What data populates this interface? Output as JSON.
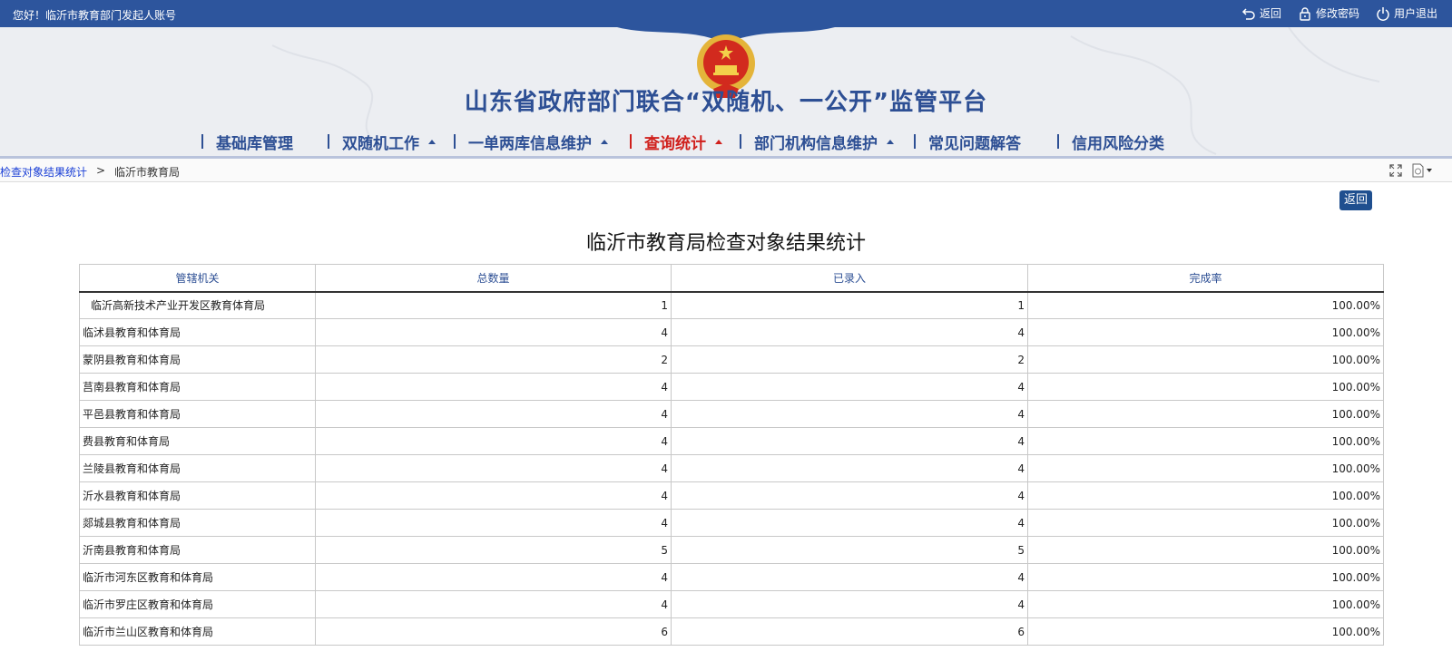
{
  "topbar": {
    "greeting": "您好！临沂市教育部门发起人账号",
    "links": [
      {
        "label": "返回",
        "icon": "back-arrow-icon"
      },
      {
        "label": "修改密码",
        "icon": "lock-icon"
      },
      {
        "label": "用户退出",
        "icon": "power-icon"
      }
    ]
  },
  "header": {
    "title": "山东省政府部门联合“双随机、一公开”监管平台",
    "emblem": "national-emblem"
  },
  "nav": [
    {
      "label": "基础库管理",
      "dropdown": false,
      "active": false
    },
    {
      "label": "双随机工作",
      "dropdown": true,
      "active": false
    },
    {
      "label": "一单两库信息维护",
      "dropdown": true,
      "active": false
    },
    {
      "label": "查询统计",
      "dropdown": true,
      "active": true
    },
    {
      "label": "部门机构信息维护",
      "dropdown": true,
      "active": false
    },
    {
      "label": "常见问题解答",
      "dropdown": false,
      "active": false
    },
    {
      "label": "信用风险分类",
      "dropdown": false,
      "active": false
    }
  ],
  "breadcrumb": {
    "link": "检查对象结果统计",
    "separator": ">",
    "current": "临沂市教育局"
  },
  "back_button": "返回",
  "report": {
    "title": "临沂市教育局检查对象结果统计",
    "columns": [
      "管辖机关",
      "总数量",
      "已录入",
      "完成率"
    ],
    "rows": [
      [
        "临沂高新技术产业开发区教育体育局",
        "1",
        "1",
        "100.00%"
      ],
      [
        "临沭县教育和体育局",
        "4",
        "4",
        "100.00%"
      ],
      [
        "蒙阴县教育和体育局",
        "2",
        "2",
        "100.00%"
      ],
      [
        "莒南县教育和体育局",
        "4",
        "4",
        "100.00%"
      ],
      [
        "平邑县教育和体育局",
        "4",
        "4",
        "100.00%"
      ],
      [
        "费县教育和体育局",
        "4",
        "4",
        "100.00%"
      ],
      [
        "兰陵县教育和体育局",
        "4",
        "4",
        "100.00%"
      ],
      [
        "沂水县教育和体育局",
        "4",
        "4",
        "100.00%"
      ],
      [
        "郯城县教育和体育局",
        "4",
        "4",
        "100.00%"
      ],
      [
        "沂南县教育和体育局",
        "5",
        "5",
        "100.00%"
      ],
      [
        "临沂市河东区教育和体育局",
        "4",
        "4",
        "100.00%"
      ],
      [
        "临沂市罗庄区教育和体育局",
        "4",
        "4",
        "100.00%"
      ],
      [
        "临沂市兰山区教育和体育局",
        "6",
        "6",
        "100.00%"
      ]
    ]
  },
  "colors": {
    "topbar": "#2d559d",
    "title": "#2d4f94",
    "active_nav": "#d0201c",
    "link": "#1a3fd6"
  }
}
